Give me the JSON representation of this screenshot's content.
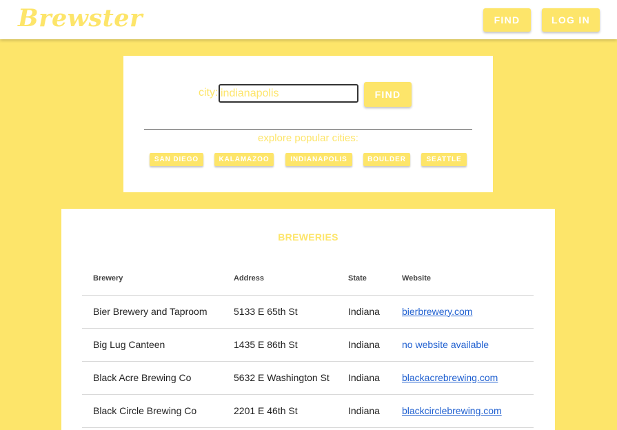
{
  "app": {
    "logo": "Brewster",
    "nav_find_label": "FIND",
    "nav_login_label": "LOG IN"
  },
  "search": {
    "city_label": "city:",
    "city_value": "indianapolis",
    "find_label": "FIND",
    "explore_label": "explore popular cities:",
    "popular_cities": [
      "SAN DIEGO",
      "KALAMAZOO",
      "INDIANAPOLIS",
      "BOULDER",
      "SEATTLE"
    ]
  },
  "results": {
    "title": "BREWERIES",
    "columns": [
      "Brewery",
      "Address",
      "State",
      "Website"
    ],
    "rows": [
      {
        "brewery": "Bier Brewery and Taproom",
        "address": "5133 E 65th St",
        "state": "Indiana",
        "website": "bierbrewery.com"
      },
      {
        "brewery": "Big Lug Canteen",
        "address": "1435 E 86th St",
        "state": "Indiana",
        "website": "no website available"
      },
      {
        "brewery": "Black Acre Brewing Co",
        "address": "5632 E Washington St",
        "state": "Indiana",
        "website": "blackacrebrewing.com"
      },
      {
        "brewery": "Black Circle Brewing Co",
        "address": "2201 E 46th St",
        "state": "Indiana",
        "website": "blackcirclebrewing.com"
      }
    ]
  },
  "colors": {
    "brand_yellow": "#fde56a",
    "link_blue": "#2060d0"
  }
}
